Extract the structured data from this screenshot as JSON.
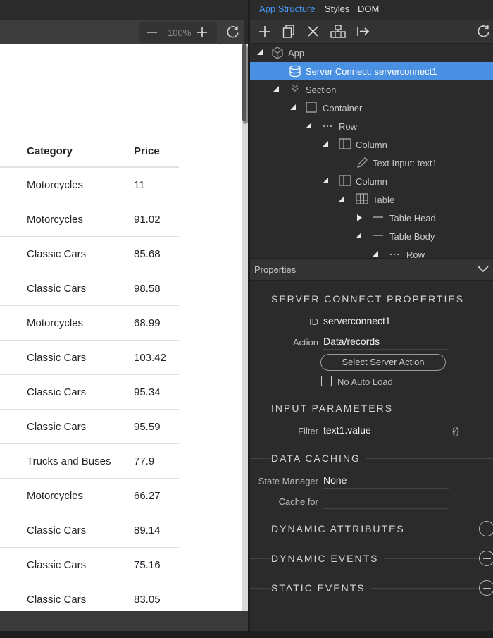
{
  "tabs": [
    {
      "label": "App Structure",
      "active": true
    },
    {
      "label": "Styles",
      "active": false
    },
    {
      "label": "DOM",
      "active": false
    }
  ],
  "design_toolbar": {
    "zoom": "100%"
  },
  "table": {
    "headers": {
      "category": "Category",
      "price": "Price"
    },
    "rows": [
      {
        "category": "Motorcycles",
        "price": "11"
      },
      {
        "category": "Motorcycles",
        "price": "91.02"
      },
      {
        "category": "Classic Cars",
        "price": "85.68"
      },
      {
        "category": "Classic Cars",
        "price": "98.58"
      },
      {
        "category": "Motorcycles",
        "price": "68.99"
      },
      {
        "category": "Classic Cars",
        "price": "103.42"
      },
      {
        "category": "Classic Cars",
        "price": "95.34"
      },
      {
        "category": "Classic Cars",
        "price": "95.59"
      },
      {
        "category": "Trucks and Buses",
        "price": "77.9"
      },
      {
        "category": "Motorcycles",
        "price": "66.27"
      },
      {
        "category": "Classic Cars",
        "price": "89.14"
      },
      {
        "category": "Classic Cars",
        "price": "75.16"
      },
      {
        "category": "Classic Cars",
        "price": "83.05"
      }
    ]
  },
  "tree": [
    {
      "label": "App",
      "icon": "cube-icon",
      "arrow": "down",
      "selected": false
    },
    {
      "label": "Server Connect: serverconnect1",
      "icon": "database-icon",
      "arrow": "",
      "selected": true
    },
    {
      "label": "Section",
      "icon": "chevrons-down-icon",
      "arrow": "down",
      "selected": false
    },
    {
      "label": "Container",
      "icon": "square-icon",
      "arrow": "down",
      "selected": false
    },
    {
      "label": "Row",
      "icon": "dots-icon",
      "arrow": "down",
      "selected": false
    },
    {
      "label": "Column",
      "icon": "column-icon",
      "arrow": "down",
      "selected": false
    },
    {
      "label": "Text Input: text1",
      "icon": "pencil-icon",
      "arrow": "",
      "selected": false
    },
    {
      "label": "Column",
      "icon": "column-icon",
      "arrow": "down",
      "selected": false
    },
    {
      "label": "Table",
      "icon": "table-icon",
      "arrow": "down",
      "selected": false
    },
    {
      "label": "Table Head",
      "icon": "dash-icon",
      "arrow": "right",
      "selected": false
    },
    {
      "label": "Table Body",
      "icon": "dash-icon",
      "arrow": "down",
      "selected": false
    },
    {
      "label": "Row",
      "icon": "dots-icon",
      "arrow": "down",
      "selected": false
    }
  ],
  "properties": {
    "header": "Properties",
    "server_connect": {
      "title": "SERVER CONNECT PROPERTIES",
      "id_label": "ID",
      "id_value": "serverconnect1",
      "action_label": "Action",
      "action_value": "Data/records",
      "select_button": "Select Server Action",
      "no_auto_load": "No Auto Load"
    },
    "input_params": {
      "title": "INPUT PARAMETERS",
      "filter_label": "Filter",
      "filter_value": "text1.value",
      "filter_icon": "{⁄}"
    },
    "data_caching": {
      "title": "DATA CACHING",
      "state_manager_label": "State Manager",
      "state_manager_value": "None",
      "cache_for_label": "Cache for",
      "cache_for_value": ""
    },
    "dynamic_attributes": "DYNAMIC ATTRIBUTES",
    "dynamic_events": "DYNAMIC EVENTS",
    "static_events": "STATIC EVENTS"
  },
  "colors": {
    "accent": "#4a9dff",
    "selected_row": "#4a90e2",
    "panel_bg": "#2b2b2b"
  }
}
